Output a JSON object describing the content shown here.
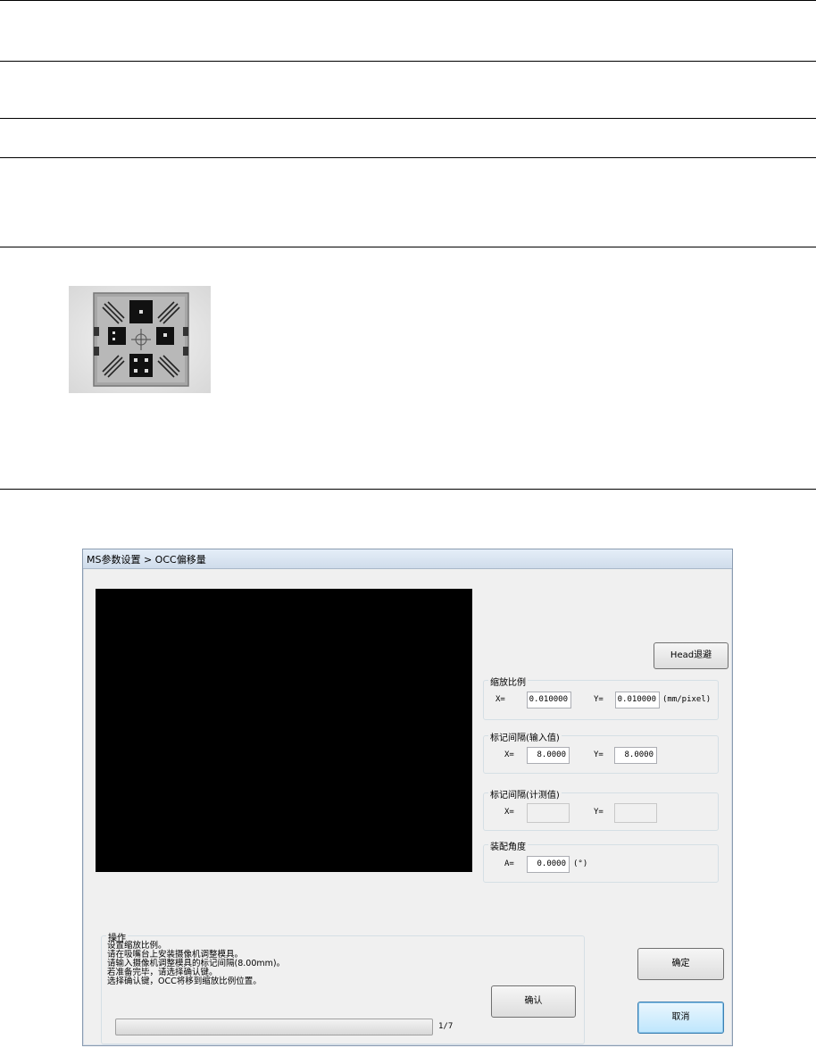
{
  "dialog": {
    "title": "MS参数设置 > OCC偏移量",
    "head_retract_button": "Head退避",
    "scale": {
      "group_label": "缩放比例",
      "x_label": "X=",
      "x_value": "0.010000",
      "y_label": "Y=",
      "y_value": "0.010000",
      "unit": "(mm/pixel)"
    },
    "mark_spacing_input": {
      "group_label": "标记间隔(输入值)",
      "x_label": "X=",
      "x_value": "8.0000",
      "y_label": "Y=",
      "y_value": "8.0000"
    },
    "mark_spacing_measured": {
      "group_label": "标记间隔(计测值)",
      "x_label": "X=",
      "x_value": "",
      "y_label": "Y=",
      "y_value": ""
    },
    "mount_angle": {
      "group_label": "装配角度",
      "a_label": "A=",
      "a_value": "0.0000",
      "unit": "(°)"
    },
    "operation": {
      "group_label": "操作",
      "lines": [
        "设置缩放比例。",
        "请在吸嘴台上安装摄像机调整模具。",
        "请输入摄像机调整模具的标记间隔(8.00mm)。",
        "若准备完毕，请选择确认键。",
        "选择确认键，OCC将移到缩放比例位置。"
      ],
      "confirm_button": "确认",
      "progress_text": "1/7",
      "progress_fraction": 0.0
    },
    "ok_button": "确定",
    "cancel_button": "取消"
  },
  "icons": {
    "jig_photo": "camera-adjustment-jig-photo"
  }
}
